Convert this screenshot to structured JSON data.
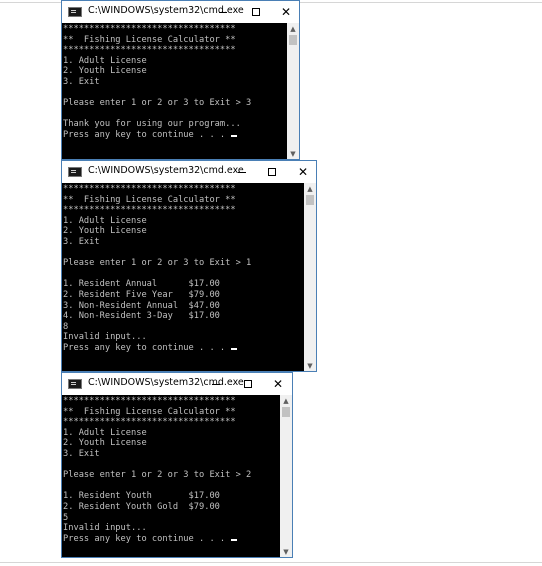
{
  "windows": [
    {
      "title": "C:\\WINDOWS\\system32\\cmd.exe",
      "lines": [
        "*********************************",
        "**  Fishing License Calculator **",
        "*********************************",
        "1. Adult License",
        "2. Youth License",
        "3. Exit",
        "",
        "Please enter 1 or 2 or 3 to Exit > 3",
        "",
        "Thank you for using our program...",
        "Press any key to continue . . . "
      ]
    },
    {
      "title": "C:\\WINDOWS\\system32\\cmd.exe",
      "lines": [
        "*********************************",
        "**  Fishing License Calculator **",
        "*********************************",
        "1. Adult License",
        "2. Youth License",
        "3. Exit",
        "",
        "Please enter 1 or 2 or 3 to Exit > 1",
        "",
        "1. Resident Annual      $17.00",
        "2. Resident Five Year   $79.00",
        "3. Non-Resident Annual  $47.00",
        "4. Non-Resident 3-Day   $17.00",
        "8",
        "Invalid input...",
        "Press any key to continue . . . "
      ]
    },
    {
      "title": "C:\\WINDOWS\\system32\\cmd.exe",
      "lines": [
        "*********************************",
        "**  Fishing License Calculator **",
        "*********************************",
        "1. Adult License",
        "2. Youth License",
        "3. Exit",
        "",
        "Please enter 1 or 2 or 3 to Exit > 2",
        "",
        "1. Resident Youth       $17.00",
        "2. Resident Youth Gold  $79.00",
        "5",
        "Invalid input...",
        "Press any key to continue . . . "
      ]
    }
  ],
  "icons": {
    "minimize": "minimize-icon",
    "maximize": "maximize-icon",
    "close": "close-icon",
    "scroll_up": "scroll-up-arrow-icon",
    "scroll_down": "scroll-down-arrow-icon"
  },
  "glyphs": {
    "close": "✕",
    "up": "▲",
    "down": "▼"
  }
}
